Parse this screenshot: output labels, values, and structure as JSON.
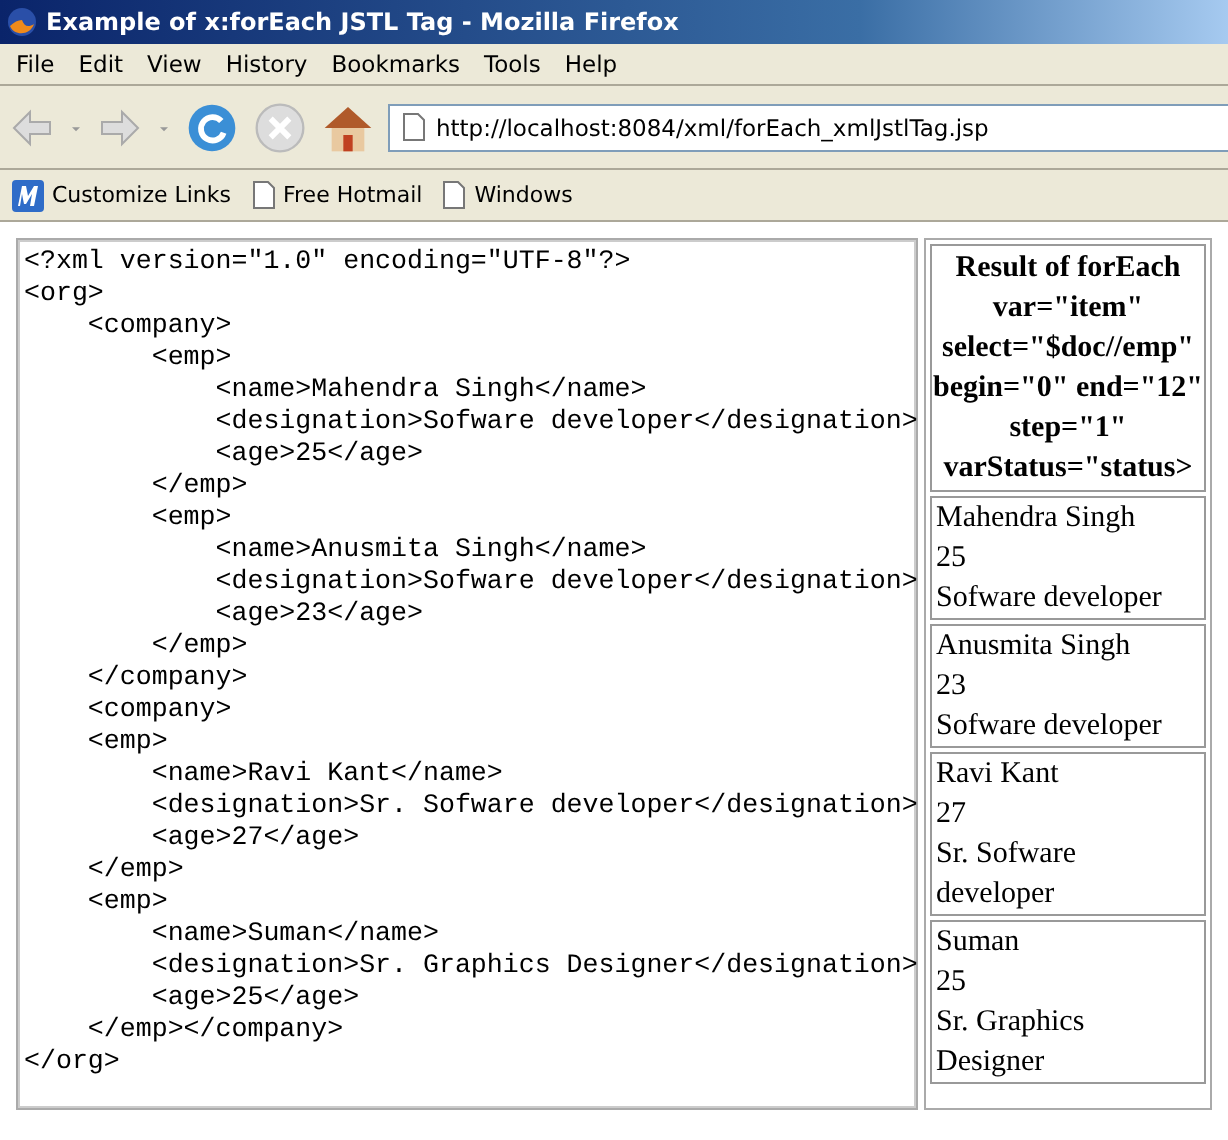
{
  "window": {
    "title": "Example of x:forEach JSTL Tag - Mozilla Firefox"
  },
  "menu": [
    "File",
    "Edit",
    "View",
    "History",
    "Bookmarks",
    "Tools",
    "Help"
  ],
  "address": {
    "value": "http://localhost:8084/xml/forEach_xmlJstlTag.jsp"
  },
  "bookmarks": [
    {
      "label": "Customize Links",
      "kind": "logo"
    },
    {
      "label": "Free Hotmail",
      "kind": "page"
    },
    {
      "label": "Windows",
      "kind": "page"
    }
  ],
  "code_lines": [
    "<?xml version=\"1.0\" encoding=\"UTF-8\"?>",
    "<org>",
    "    <company>",
    "        <emp>",
    "            <name>Mahendra Singh</name>",
    "            <designation>Sofware developer</designation>",
    "            <age>25</age>",
    "        </emp>",
    "        <emp>",
    "            <name>Anusmita Singh</name>",
    "            <designation>Sofware developer</designation>",
    "            <age>23</age>",
    "        </emp>",
    "    </company>",
    "    <company>",
    "    <emp>",
    "        <name>Ravi Kant</name>",
    "        <designation>Sr. Sofware developer</designation>",
    "        <age>27</age>",
    "    </emp>",
    "    <emp>",
    "        <name>Suman</name>",
    "        <designation>Sr. Graphics Designer</designation>",
    "        <age>25</age>",
    "    </emp></company>",
    "</org>"
  ],
  "result_table": {
    "header": "Result of forEach var=\"item\" select=\"$doc//emp\" begin=\"0\" end=\"12\" step=\"1\" varStatus=\"status>",
    "rows": [
      {
        "name": "Mahendra Singh",
        "age": "25",
        "designation": "Sofware developer"
      },
      {
        "name": "Anusmita Singh",
        "age": "23",
        "designation": "Sofware developer"
      },
      {
        "name": "Ravi Kant",
        "age": "27",
        "designation": "Sr. Sofware developer"
      },
      {
        "name": "Suman",
        "age": "25",
        "designation": "Sr. Graphics Designer"
      }
    ]
  }
}
